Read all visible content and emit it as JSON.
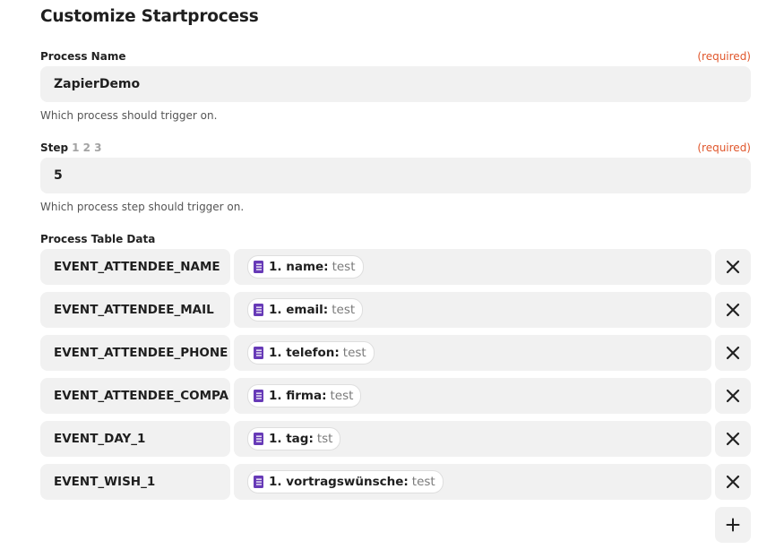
{
  "page": {
    "title": "Customize Startprocess"
  },
  "process_name": {
    "label": "Process Name",
    "required": "(required)",
    "value": "ZapierDemo",
    "help": "Which process should trigger on."
  },
  "step": {
    "label": "Step",
    "hint": "1 2 3",
    "required": "(required)",
    "value": "5",
    "help": "Which process step should trigger on."
  },
  "table": {
    "label": "Process Table Data",
    "rows": [
      {
        "key": "EVENT_ATTENDEE_NAME",
        "field": "1. name:",
        "value": "test"
      },
      {
        "key": "EVENT_ATTENDEE_MAIL",
        "field": "1. email:",
        "value": "test"
      },
      {
        "key": "EVENT_ATTENDEE_PHONE",
        "field": "1. telefon:",
        "value": "test"
      },
      {
        "key": "EVENT_ATTENDEE_COMPA",
        "field": "1. firma:",
        "value": "test"
      },
      {
        "key": "EVENT_DAY_1",
        "field": "1. tag:",
        "value": "tst"
      },
      {
        "key": "EVENT_WISH_1",
        "field": "1. vortragswünsche:",
        "value": "test"
      }
    ]
  },
  "icons": {
    "field_icon": "google-forms-icon",
    "delete": "close-icon",
    "add": "plus-icon"
  },
  "colors": {
    "required": "#e0562b",
    "field_bg": "#f1f1f1",
    "forms_icon": "#673ab7"
  }
}
